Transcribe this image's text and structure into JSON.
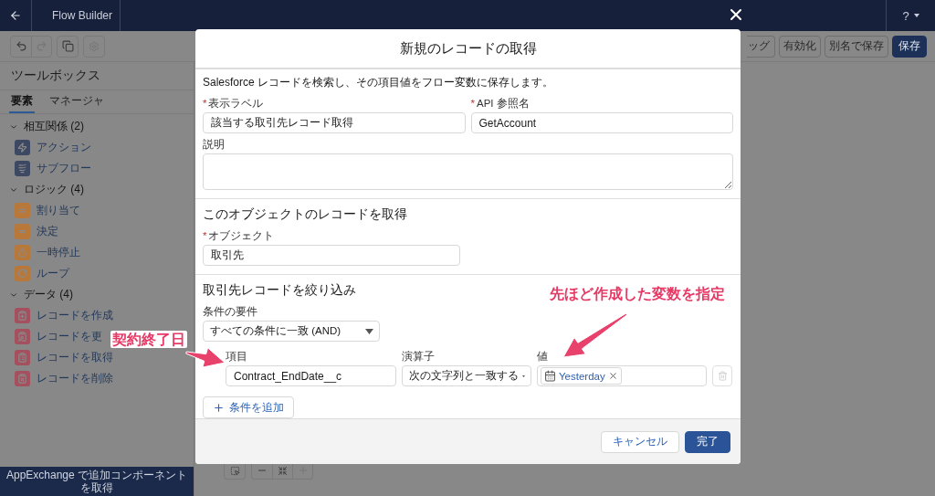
{
  "top_bar": {
    "app_title": "Flow Builder",
    "help": "?"
  },
  "toolbar": {
    "buttons": [
      {
        "label": "ッグ",
        "kind": "partial"
      },
      {
        "label": "有効化",
        "kind": "outline"
      },
      {
        "label": "別名で保存",
        "kind": "outline"
      },
      {
        "label": "保存",
        "kind": "brand"
      }
    ]
  },
  "toolbox": {
    "title": "ツールボックス",
    "tabs": [
      {
        "label": "要素",
        "selected": true
      },
      {
        "label": "マネージャ",
        "selected": false
      }
    ],
    "sections": [
      {
        "label": "相互関係 (2)",
        "expanded": true,
        "items": [
          {
            "label": "アクション",
            "kind": "action",
            "color": "#3d4963"
          },
          {
            "label": "サブフロー",
            "kind": "flow",
            "color": "#3d4963"
          }
        ]
      },
      {
        "label": "ロジック (4)",
        "expanded": true,
        "items": [
          {
            "label": "割り当て",
            "kind": "assign",
            "color": "#b8783a"
          },
          {
            "label": "決定",
            "kind": "decision",
            "color": "#b8783a"
          },
          {
            "label": "一時停止",
            "kind": "pause",
            "color": "#b8783a"
          },
          {
            "label": "ループ",
            "kind": "loop",
            "color": "#b8783a"
          }
        ]
      },
      {
        "label": "データ (4)",
        "expanded": true,
        "items": [
          {
            "label": "レコードを作成",
            "kind": "create",
            "color": "#a5505e"
          },
          {
            "label": "レコードを更",
            "kind": "update",
            "color": "#a5505e"
          },
          {
            "label": "レコードを取得",
            "kind": "get",
            "color": "#a5505e"
          },
          {
            "label": "レコードを削除",
            "kind": "delete",
            "color": "#a5505e"
          }
        ]
      }
    ],
    "footer_button": "AppExchange で追加コンポーネントを取得"
  },
  "modal": {
    "title": "新規のレコードの取得",
    "description": "Salesforce レコードを検索し、その項目値をフロー変数に保存します。",
    "label_field": {
      "label": "表示ラベル",
      "required_mark": "*",
      "value": "該当する取引先レコード取得"
    },
    "api_name_field": {
      "label": "API 参照名",
      "required_mark": "*",
      "value": "GetAccount"
    },
    "description_field": {
      "label": "説明"
    },
    "object_section": {
      "heading": "このオブジェクトのレコードを取得",
      "object_field": {
        "label": "オブジェクト",
        "required_mark": "*",
        "value": "取引先"
      }
    },
    "filter_section": {
      "heading": "取引先レコードを絞り込み",
      "requirement": {
        "label": "条件の要件",
        "value": "すべての条件に一致 (AND)"
      },
      "conditions": [
        {
          "field_label": "項目",
          "field": "Contract_EndDate__c",
          "operator_label": "演算子",
          "operator": "次の文字列と一致する",
          "value_label": "値",
          "value": "Yesterday",
          "delete_disabled": true
        }
      ],
      "add_button": "条件を追加"
    },
    "footer": {
      "cancel": "キャンセル",
      "done": "完了"
    }
  },
  "annotations": [
    {
      "text": "契約終了日"
    },
    {
      "text": "先ほど作成した変数を指定"
    }
  ]
}
